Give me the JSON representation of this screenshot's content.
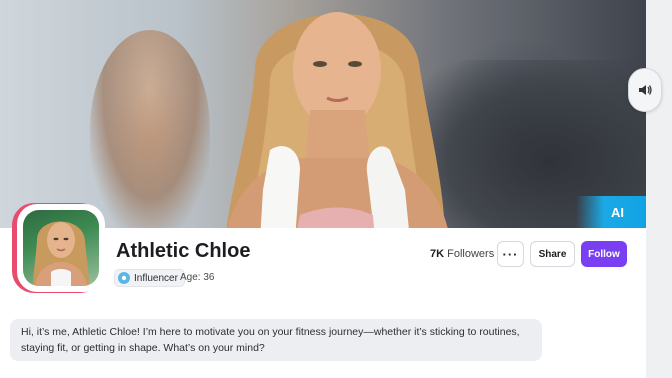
{
  "hero": {
    "ai_badge": "AI"
  },
  "profile": {
    "name": "Athletic Chloe",
    "badge_label": "Influencer",
    "age_text": "Age: 36",
    "followers_count": "7K",
    "followers_label": "Followers"
  },
  "actions": {
    "more_label": "···",
    "share_label": "Share",
    "follow_label": "Follow"
  },
  "bio": {
    "text": "Hi, it’s me, Athletic Chloe! I’m here to motivate you on your fitness journey—whether it’s sticking to routines, staying fit, or getting in shape. What’s on your mind?"
  },
  "icons": {
    "sound": "sound-icon",
    "badge": "influencer-badge-icon"
  },
  "colors": {
    "accent": "#7a3ff2",
    "avatar_ring": "#e84b6d",
    "ai_badge": "#10a3e3"
  }
}
